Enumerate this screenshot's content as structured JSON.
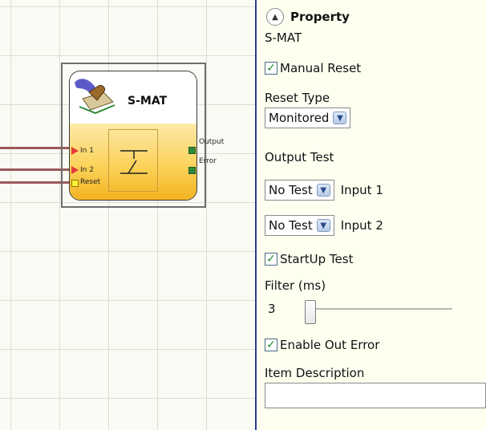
{
  "canvas": {
    "block": {
      "title": "S-MAT",
      "inputs": [
        "In 1",
        "In 2"
      ],
      "reset_label": "Reset",
      "outputs": [
        "Output",
        "Error"
      ]
    }
  },
  "panel": {
    "header": {
      "title": "Property",
      "collapse_icon": "chevron-up-icon"
    },
    "component_name": "S-MAT",
    "manual_reset": {
      "label": "Manual Reset",
      "checked": true
    },
    "reset_type": {
      "label": "Reset Type",
      "value": "Monitored"
    },
    "output_test": {
      "label": "Output Test",
      "rows": [
        {
          "value": "No Test",
          "input_label": "Input 1"
        },
        {
          "value": "No Test",
          "input_label": "Input 2"
        }
      ]
    },
    "startup_test": {
      "label": "StartUp Test",
      "checked": true
    },
    "filter": {
      "label": "Filter (ms)",
      "value": "3"
    },
    "enable_out_error": {
      "label": "Enable Out Error",
      "checked": true
    },
    "item_description": {
      "label": "Item Description",
      "value": ""
    }
  },
  "colors": {
    "panel_bg": "#fffff0",
    "block_gradient_top": "#fde9a8",
    "block_gradient_bottom": "#f3b11e",
    "output_pin": "#2f8a3a",
    "input_pin": "#e23a3a",
    "reset_pin": "#ffef3a",
    "divider": "#2d3a8a"
  }
}
